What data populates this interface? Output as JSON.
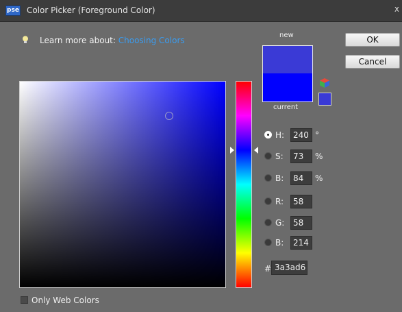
{
  "window": {
    "app_badge": "pse",
    "title": "Color Picker (Foreground Color)",
    "close_glyph": "x"
  },
  "info": {
    "prefix": "Learn more about:",
    "link": "Choosing Colors",
    "icon": "lightbulb-icon"
  },
  "swatches": {
    "new_label": "new",
    "current_label": "current",
    "new_color": "#3a3ad6",
    "current_color": "#0000ff"
  },
  "buttons": {
    "ok": "OK",
    "cancel": "Cancel"
  },
  "hsb": {
    "h": {
      "label": "H:",
      "value": "240",
      "unit": "°",
      "selected": true
    },
    "s": {
      "label": "S:",
      "value": "73",
      "unit": "%"
    },
    "b": {
      "label": "B:",
      "value": "84",
      "unit": "%"
    }
  },
  "rgb": {
    "r": {
      "label": "R:",
      "value": "58"
    },
    "g": {
      "label": "G:",
      "value": "58"
    },
    "b": {
      "label": "B:",
      "value": "214"
    }
  },
  "hex": {
    "symbol": "#",
    "value": "3a3ad6"
  },
  "options": {
    "only_web_colors": "Only Web Colors"
  },
  "colors": {
    "field_hue": "#0000ff",
    "link": "#3a9cf0",
    "background": "#6b6b6b"
  },
  "icons": [
    "lightbulb-icon",
    "gamut-cube-icon",
    "close-icon"
  ]
}
